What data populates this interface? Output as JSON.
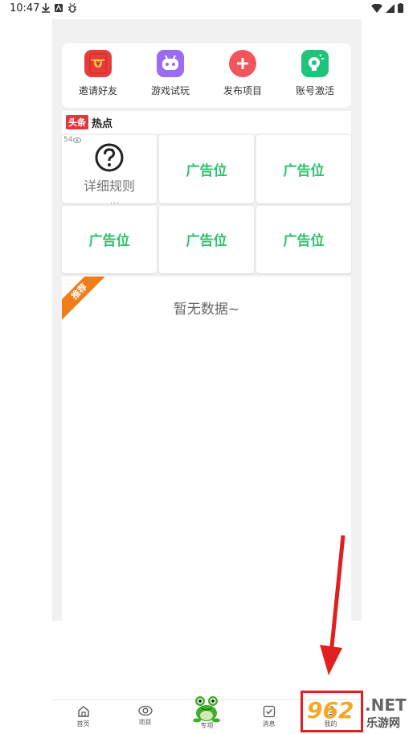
{
  "status_bar": {
    "time": "10:47"
  },
  "quick_actions": [
    {
      "label": "邀请好友",
      "icon": "red-envelope-icon",
      "color": "#e63c3c",
      "glyph": "¥"
    },
    {
      "label": "游戏试玩",
      "icon": "game-robot-icon",
      "color": "#9b6cf2",
      "glyph": "••"
    },
    {
      "label": "发布项目",
      "icon": "plus-icon",
      "color": "#f2565a",
      "glyph": "+"
    },
    {
      "label": "账号激活",
      "icon": "lightbulb-icon",
      "color": "#1fc47a",
      "glyph": "✦"
    }
  ],
  "headlines": {
    "badge": "头条",
    "title": "热点"
  },
  "grid": {
    "rules": {
      "count": "54",
      "label": "详细规则",
      "dots": "···"
    },
    "ad_label": "广告位"
  },
  "recommend": {
    "ribbon": "推荐",
    "empty_text": "暂无数据~"
  },
  "bottom_nav": [
    {
      "label": "首页",
      "icon": "home-icon"
    },
    {
      "label": "项目",
      "icon": "eye-icon"
    },
    {
      "label": "专项",
      "icon": "frog-icon"
    },
    {
      "label": "消息",
      "icon": "checkbox-icon"
    },
    {
      "label": "我的",
      "icon": "user-icon"
    }
  ],
  "watermark": {
    "number": "962",
    "net": ".NET",
    "cn": "乐游网"
  },
  "colors": {
    "ad_green": "#2dc26b",
    "accent_red": "#e02020",
    "ribbon_orange": "#f07d18"
  }
}
